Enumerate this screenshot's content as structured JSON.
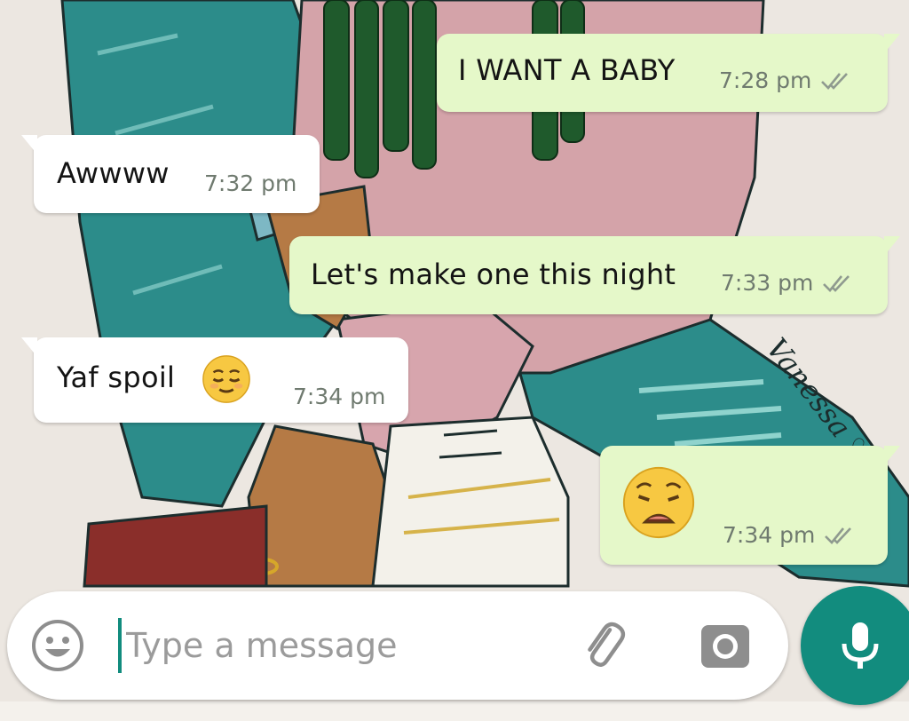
{
  "chat": {
    "messages": [
      {
        "direction": "outgoing",
        "text": "I WANT A BABY",
        "time": "7:28 pm",
        "status": "read"
      },
      {
        "direction": "incoming",
        "text": "Awwww",
        "time": "7:32 pm"
      },
      {
        "direction": "outgoing",
        "text": "Let's make one this night",
        "time": "7:33 pm",
        "status": "read"
      },
      {
        "direction": "incoming",
        "text": "Yaf spoil",
        "emoji": "relieved-face",
        "time": "7:34 pm"
      },
      {
        "direction": "outgoing",
        "emoji": "weary-face",
        "time": "7:34 pm",
        "status": "read"
      }
    ]
  },
  "wallpaper": {
    "signature": "Vanessa"
  },
  "composer": {
    "placeholder": "Type a message",
    "emoji_icon": "emoji-icon",
    "attach_icon": "paperclip-icon",
    "camera_icon": "camera-icon",
    "mic_icon": "microphone-icon"
  },
  "colors": {
    "outgoing_bubble": "#e5f8c9",
    "incoming_bubble": "#ffffff",
    "accent": "#128c7e",
    "timestamp": "#6f7a6f"
  }
}
